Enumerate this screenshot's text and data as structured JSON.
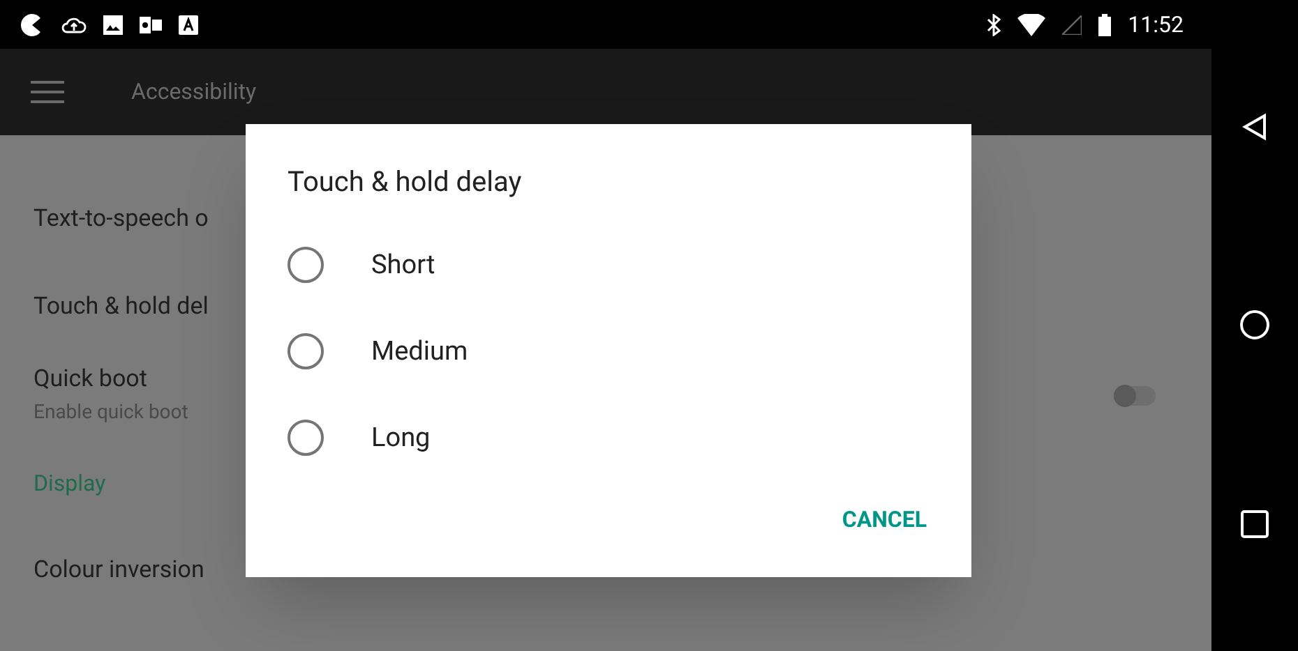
{
  "status_bar": {
    "time": "11:52"
  },
  "app_bar": {
    "title": "Accessibility"
  },
  "settings": [
    {
      "kind": "item",
      "title": "Text-to-speech o"
    },
    {
      "kind": "item",
      "title": "Touch & hold del"
    },
    {
      "kind": "switch",
      "title": "Quick boot",
      "subtitle": "Enable quick boot",
      "on": false
    },
    {
      "kind": "header",
      "title": "Display"
    },
    {
      "kind": "item",
      "title": "Colour inversion"
    }
  ],
  "dialog": {
    "title": "Touch & hold delay",
    "options": [
      {
        "label": "Short",
        "selected": false
      },
      {
        "label": "Medium",
        "selected": false
      },
      {
        "label": "Long",
        "selected": false
      }
    ],
    "button": "CANCEL"
  }
}
